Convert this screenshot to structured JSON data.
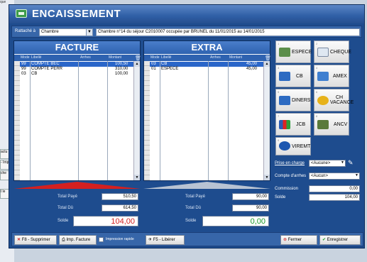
{
  "background": {
    "corner_text": "que",
    "strips": [
      "actu",
      "- Imp",
      "che",
      "l le"
    ]
  },
  "window": {
    "title": "ENCAISSEMENT",
    "attached_label": "Rattaché à",
    "attached_value": "Chambre",
    "attached_desc": "Chambre n°14 du séjour C2010007 occupée par BRUNEL du 11/01/2015 au 14/01/2015"
  },
  "facture": {
    "header": "FACTURE",
    "columns": {
      "mode": "Mode",
      "libelle": "Libellé",
      "arrhes": "Arrhes",
      "montant": "Montant"
    },
    "rows": [
      {
        "mode": "99",
        "libelle": "COMPTE BEC",
        "montant": "100,50",
        "selected": true
      },
      {
        "mode": "99",
        "libelle": "COMPTE PERR",
        "montant": "310,00",
        "selected": false
      },
      {
        "mode": "03",
        "libelle": "CB",
        "montant": "100,00",
        "selected": false
      }
    ],
    "total_paye_label": "Total Payé",
    "total_paye": "510,50",
    "total_du_label": "Total Dû",
    "total_du": "614,50",
    "solde_label": "Solde",
    "solde": "104,00",
    "solde_color": "#d01f1f"
  },
  "extra": {
    "header": "EXTRA",
    "columns": {
      "mode": "Mode",
      "libelle": "Libellé",
      "arrhes": "Arrhes",
      "montant": "Montant"
    },
    "rows": [
      {
        "mode": "03",
        "libelle": "CB",
        "montant": "45,00",
        "selected": true
      },
      {
        "mode": "01",
        "libelle": "ESPECE",
        "montant": "45,00",
        "selected": false
      }
    ],
    "total_paye_label": "Total Payé",
    "total_paye": "90,00",
    "total_du_label": "Total Dû",
    "total_du": "90,00",
    "solde_label": "Solde",
    "solde": "0,00",
    "solde_color": "#1b9a2a"
  },
  "payment_modes": [
    {
      "label": "ESPECE",
      "icon": "cash-icon"
    },
    {
      "label": "CHEQUE",
      "icon": "cheque-icon"
    },
    {
      "label": "CB",
      "icon": "credit-card-icon"
    },
    {
      "label": "AMEX",
      "icon": "amex-card-icon"
    },
    {
      "label": "DINERS",
      "icon": "diners-card-icon"
    },
    {
      "label": "CH VACANCE",
      "icon": "holiday-voucher-icon"
    },
    {
      "label": "JCB",
      "icon": "jcb-card-icon"
    },
    {
      "label": "ANCV",
      "icon": "ancv-voucher-icon"
    },
    {
      "label": "VIREMT",
      "icon": "transfer-icon"
    }
  ],
  "right_panel": {
    "prise_label": "Prise en charge",
    "prise_value": "<Aucune>",
    "compte_label": "Compte d'arrhes",
    "compte_value": "<Aucun>",
    "commission_label": "Commission",
    "commission_value": "0,00",
    "solde_label": "Solde",
    "solde_value": "104,00"
  },
  "bottom": {
    "delete_label": "F8 - Supprimer",
    "print_label": "Imp. Facture",
    "quick_print_label": "Impression rapide",
    "release_label": "F5 - Libérer",
    "close_label": "Fermer",
    "save_label": "Enregistrer"
  },
  "colors": {
    "accent_blue": "#1e4c8e",
    "selection": "#2a66c9",
    "negative": "#d01f1f",
    "positive": "#1b9a2a"
  }
}
